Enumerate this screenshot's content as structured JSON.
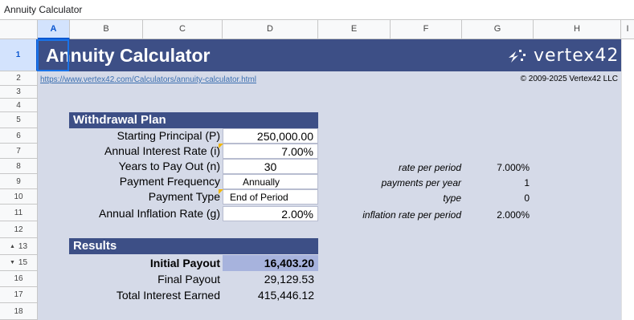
{
  "formula_bar": {
    "content": "Annuity Calculator"
  },
  "columns": [
    "A",
    "B",
    "C",
    "D",
    "E",
    "F",
    "G",
    "H",
    "I"
  ],
  "rows": [
    "1",
    "2",
    "3",
    "4",
    "5",
    "6",
    "7",
    "8",
    "9",
    "10",
    "11",
    "12",
    "13",
    "15",
    "16",
    "17",
    "18"
  ],
  "row_arrows": {
    "up": "▲",
    "down": "▼"
  },
  "banner": {
    "title": "Annuity Calculator",
    "logo": "vertex42"
  },
  "link": "https://www.vertex42.com/Calculators/annuity-calculator.html",
  "copyright": "© 2009-2025 Vertex42 LLC",
  "withdrawal": {
    "heading": "Withdrawal Plan",
    "starting_principal": {
      "label": "Starting Principal (P)",
      "value": "250,000.00"
    },
    "interest_rate": {
      "label": "Annual Interest Rate (i)",
      "value": "7.00%"
    },
    "years": {
      "label": "Years to Pay Out (n)",
      "value": "30"
    },
    "frequency": {
      "label": "Payment Frequency",
      "value": "Annually"
    },
    "payment_type": {
      "label": "Payment Type",
      "value": "End of Period"
    },
    "inflation": {
      "label": "Annual Inflation Rate (g)",
      "value": "2.00%"
    }
  },
  "side": {
    "rate_per_period": {
      "label": "rate per period",
      "value": "7.000%"
    },
    "payments_per_year": {
      "label": "payments per year",
      "value": "1"
    },
    "type": {
      "label": "type",
      "value": "0"
    },
    "inflation_per_period": {
      "label": "inflation rate per period",
      "value": "2.000%"
    }
  },
  "results": {
    "heading": "Results",
    "initial_payout": {
      "label": "Initial Payout",
      "value": "16,403.20"
    },
    "final_payout": {
      "label": "Final Payout",
      "value": "29,129.53"
    },
    "total_interest": {
      "label": "Total Interest Earned",
      "value": "415,446.12"
    }
  },
  "colors": {
    "banner": "#3d4f86",
    "sheet": "#d5dae8",
    "highlight": "#a7b3dd",
    "note": "#f2b600"
  }
}
